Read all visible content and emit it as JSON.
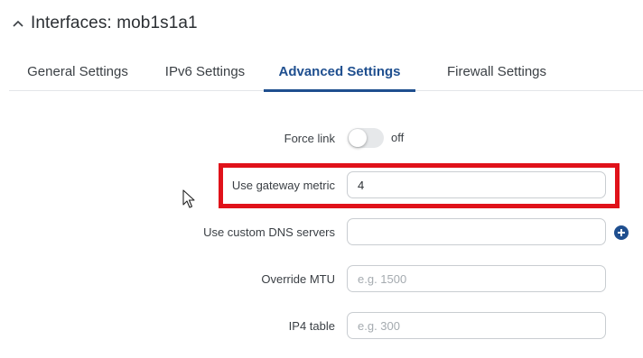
{
  "header": {
    "title": "Interfaces: mob1s1a1",
    "collapse_icon": "chevron-up-icon"
  },
  "tabs": [
    {
      "label": "General Settings",
      "active": false
    },
    {
      "label": "IPv6 Settings",
      "active": false
    },
    {
      "label": "Advanced Settings",
      "active": true
    },
    {
      "label": "Firewall Settings",
      "active": false
    }
  ],
  "form": {
    "force_link": {
      "label": "Force link",
      "state": "off"
    },
    "gateway_metric": {
      "label": "Use gateway metric",
      "value": "4"
    },
    "dns_servers": {
      "label": "Use custom DNS servers",
      "value": "",
      "add_icon": "plus-circle-icon"
    },
    "mtu": {
      "label": "Override MTU",
      "value": "",
      "placeholder": "e.g. 1500"
    },
    "ip4_table": {
      "label": "IP4 table",
      "value": "",
      "placeholder": "e.g. 300"
    }
  },
  "colors": {
    "accent": "#1f4f8f",
    "highlight": "#e0121a"
  }
}
